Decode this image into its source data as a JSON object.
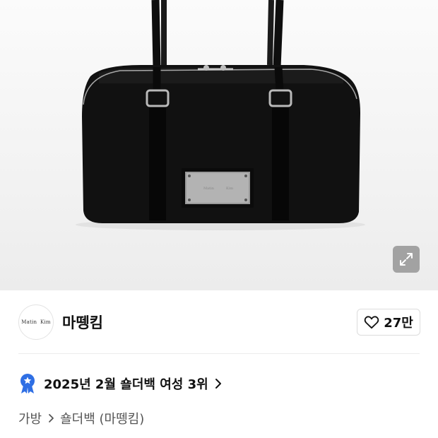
{
  "product_image": {
    "plate_text_left": "Matin",
    "plate_text_right": "Kim"
  },
  "brand": {
    "logo_text": "Matin  Kim",
    "name": "마뗑킴"
  },
  "like": {
    "count": "27만"
  },
  "ranking": {
    "text": "2025년 2월 숄더백 여성 3위"
  },
  "breadcrumb": {
    "items": [
      "가방",
      "숄더백 (마뗑킴)"
    ]
  },
  "colors": {
    "rank_badge": "#2f6fe4",
    "text_primary": "#111111",
    "text_secondary": "#555555"
  },
  "icons": {
    "expand": "expand-arrows-icon",
    "heart": "heart-outline-icon",
    "rank_badge": "award-ribbon-icon",
    "chevron": "chevron-right-icon"
  }
}
